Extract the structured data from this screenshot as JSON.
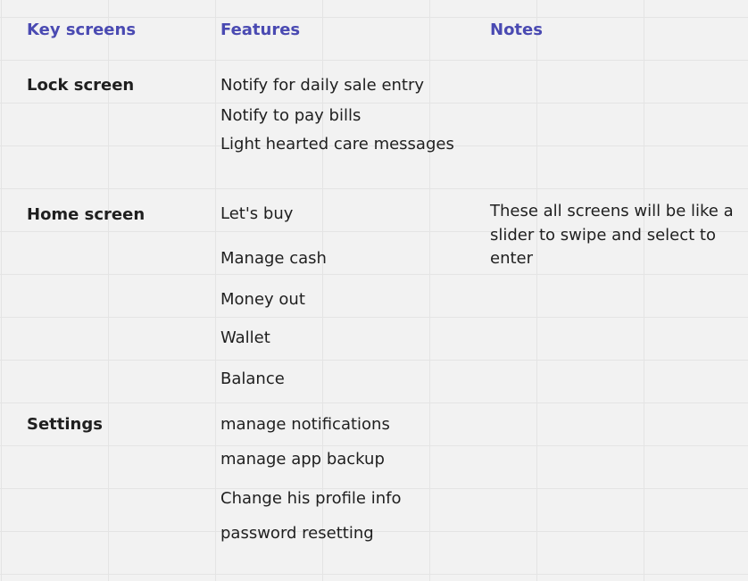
{
  "headers": {
    "key_screens": "Key screens",
    "features": "Features",
    "notes": "Notes"
  },
  "sections": [
    {
      "name": "Lock screen",
      "features": [
        "Notify for daily sale entry",
        "Notify to pay bills",
        "Light hearted care messages"
      ]
    },
    {
      "name": "Home screen",
      "features": [
        "Let's buy",
        "Manage cash",
        "Money out",
        "Wallet",
        "Balance"
      ],
      "note": "These all screens will be like a slider to swipe and select to enter"
    },
    {
      "name": "Settings",
      "features": [
        "manage notifications",
        "manage app backup",
        "Change his profile info",
        "password resetting"
      ]
    }
  ],
  "colors": {
    "header": "#4a4ab2",
    "text": "#1f1f1f",
    "background": "#f2f2f2",
    "grid": "#e4e4e4"
  }
}
